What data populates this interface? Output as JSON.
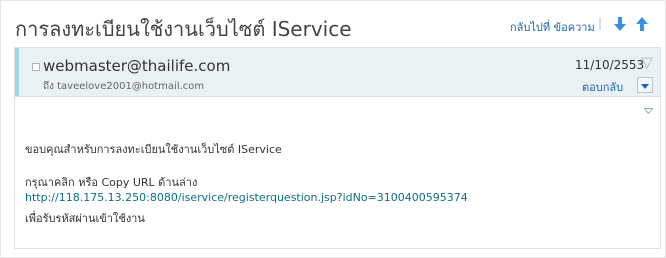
{
  "header": {
    "subject": "การลงทะเบียนใช้งานเว็บไซต์ IService",
    "back_link": "กลับไปที่ ข้อความ",
    "separator": "|",
    "nav_down_icon": "arrow-down-icon",
    "nav_up_icon": "arrow-up-icon"
  },
  "message": {
    "sender": "webmaster@thailife.com",
    "to": "ถึง taveelove2001@hotmail.com",
    "date": "11/10/2553",
    "reply_label": "ตอบกลับ",
    "flag_icon": "flag-icon",
    "body": {
      "line1": "ขอบคุณสำหรับการลงทะเบียนใช้งานเว็บไซต์ IService",
      "line2": "กรุณาคลิก หรือ Copy URL ด้านล่าง",
      "url": "http://118.175.13.250:8080/iservice/registerquestion.jsp?idNo=3100400595374",
      "line4": "เพื่อรับรหัสผ่านเข้าใช้งาน"
    }
  },
  "colors": {
    "link": "#1a66b8",
    "url": "#0d6f86",
    "arrow": "#3a8ee6",
    "header_bg": "#e9f1f4",
    "accent": "#9fd8e6"
  }
}
